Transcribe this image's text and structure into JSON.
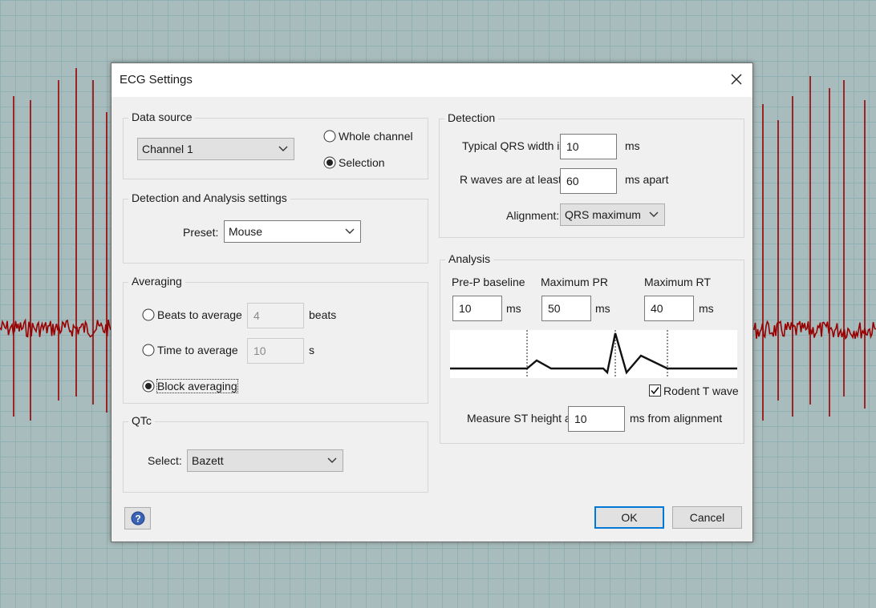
{
  "dialog": {
    "title": "ECG Settings"
  },
  "data_source": {
    "legend": "Data source",
    "channel_value": "Channel 1",
    "option_whole_channel": "Whole channel",
    "option_selection": "Selection",
    "selected_option": "Selection"
  },
  "detection_analysis_settings": {
    "legend": "Detection and Analysis settings",
    "preset_label": "Preset:",
    "preset_value": "Mouse"
  },
  "averaging": {
    "legend": "Averaging",
    "beats_label": "Beats to average",
    "beats_value": "4",
    "beats_unit": "beats",
    "time_label": "Time to average",
    "time_value": "10",
    "time_unit": "s",
    "block_label": "Block averaging",
    "selected_option": "Block averaging"
  },
  "qtc": {
    "legend": "QTc",
    "select_label": "Select:",
    "select_value": "Bazett"
  },
  "detection": {
    "legend": "Detection",
    "qrs_width_label": "Typical QRS width is",
    "qrs_width_value": "10",
    "qrs_width_unit": "ms",
    "r_waves_label": "R waves are at least",
    "r_waves_value": "60",
    "r_waves_unit": "ms apart",
    "alignment_label": "Alignment:",
    "alignment_value": "QRS maximum"
  },
  "analysis": {
    "legend": "Analysis",
    "pre_p_label": "Pre-P baseline",
    "pre_p_value": "10",
    "pre_p_unit": "ms",
    "max_pr_label": "Maximum PR",
    "max_pr_value": "50",
    "max_pr_unit": "ms",
    "max_rt_label": "Maximum RT",
    "max_rt_value": "40",
    "max_rt_unit": "ms",
    "rodent_t_wave_label": "Rodent T wave",
    "rodent_t_wave_checked": true,
    "st_height_label": "Measure ST height at",
    "st_height_value": "10",
    "st_height_unit": "ms from alignment"
  },
  "buttons": {
    "ok": "OK",
    "cancel": "Cancel",
    "help_icon": "help-icon"
  },
  "colors": {
    "ecg_trace": "#990000",
    "grid": "#8fb1b3",
    "dialog_bg": "#f0f0f0",
    "accent": "#0078d7"
  }
}
